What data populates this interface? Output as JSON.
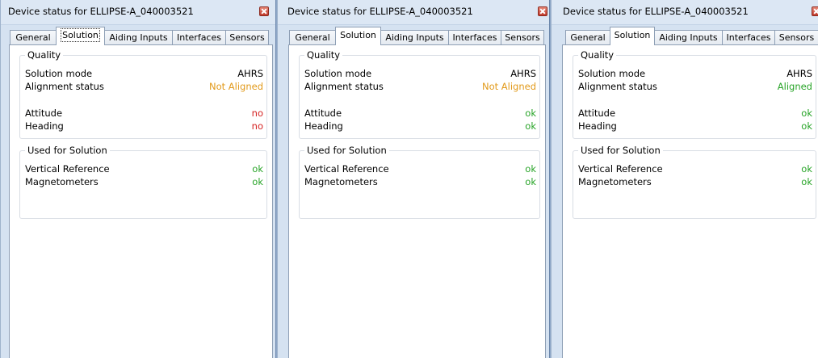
{
  "panels": [
    {
      "title": "Device status for ELLIPSE-A_040003521",
      "tabs": [
        "General",
        "Solution",
        "Aiding Inputs",
        "Interfaces",
        "Sensors"
      ],
      "active_tab": "Solution",
      "quality_title": "Quality",
      "solution_mode_label": "Solution mode",
      "solution_mode_value": "AHRS",
      "alignment_label": "Alignment status",
      "alignment_value": "Not Aligned",
      "attitude_label": "Attitude",
      "attitude_value": "no",
      "heading_label": "Heading",
      "heading_value": "no",
      "used_title": "Used for Solution",
      "vertical_label": "Vertical Reference",
      "vertical_value": "ok",
      "mag_label": "Magnetometers",
      "mag_value": "ok"
    },
    {
      "title": "Device status for ELLIPSE-A_040003521",
      "tabs": [
        "General",
        "Solution",
        "Aiding Inputs",
        "Interfaces",
        "Sensors"
      ],
      "active_tab": "Solution",
      "quality_title": "Quality",
      "solution_mode_label": "Solution mode",
      "solution_mode_value": "AHRS",
      "alignment_label": "Alignment status",
      "alignment_value": "Not Aligned",
      "attitude_label": "Attitude",
      "attitude_value": "ok",
      "heading_label": "Heading",
      "heading_value": "ok",
      "used_title": "Used for Solution",
      "vertical_label": "Vertical Reference",
      "vertical_value": "ok",
      "mag_label": "Magnetometers",
      "mag_value": "ok"
    },
    {
      "title": "Device status for ELLIPSE-A_040003521",
      "tabs": [
        "General",
        "Solution",
        "Aiding Inputs",
        "Interfaces",
        "Sensors"
      ],
      "active_tab": "Solution",
      "quality_title": "Quality",
      "solution_mode_label": "Solution mode",
      "solution_mode_value": "AHRS",
      "alignment_label": "Alignment status",
      "alignment_value": "Aligned",
      "attitude_label": "Attitude",
      "attitude_value": "ok",
      "heading_label": "Heading",
      "heading_value": "ok",
      "used_title": "Used for Solution",
      "vertical_label": "Vertical Reference",
      "vertical_value": "ok",
      "mag_label": "Magnetometers",
      "mag_value": "ok"
    }
  ],
  "colors": {
    "ok": "#28a428",
    "warning": "#e29a1b",
    "error": "#d42020",
    "window_frame": "#d5e2f1"
  }
}
